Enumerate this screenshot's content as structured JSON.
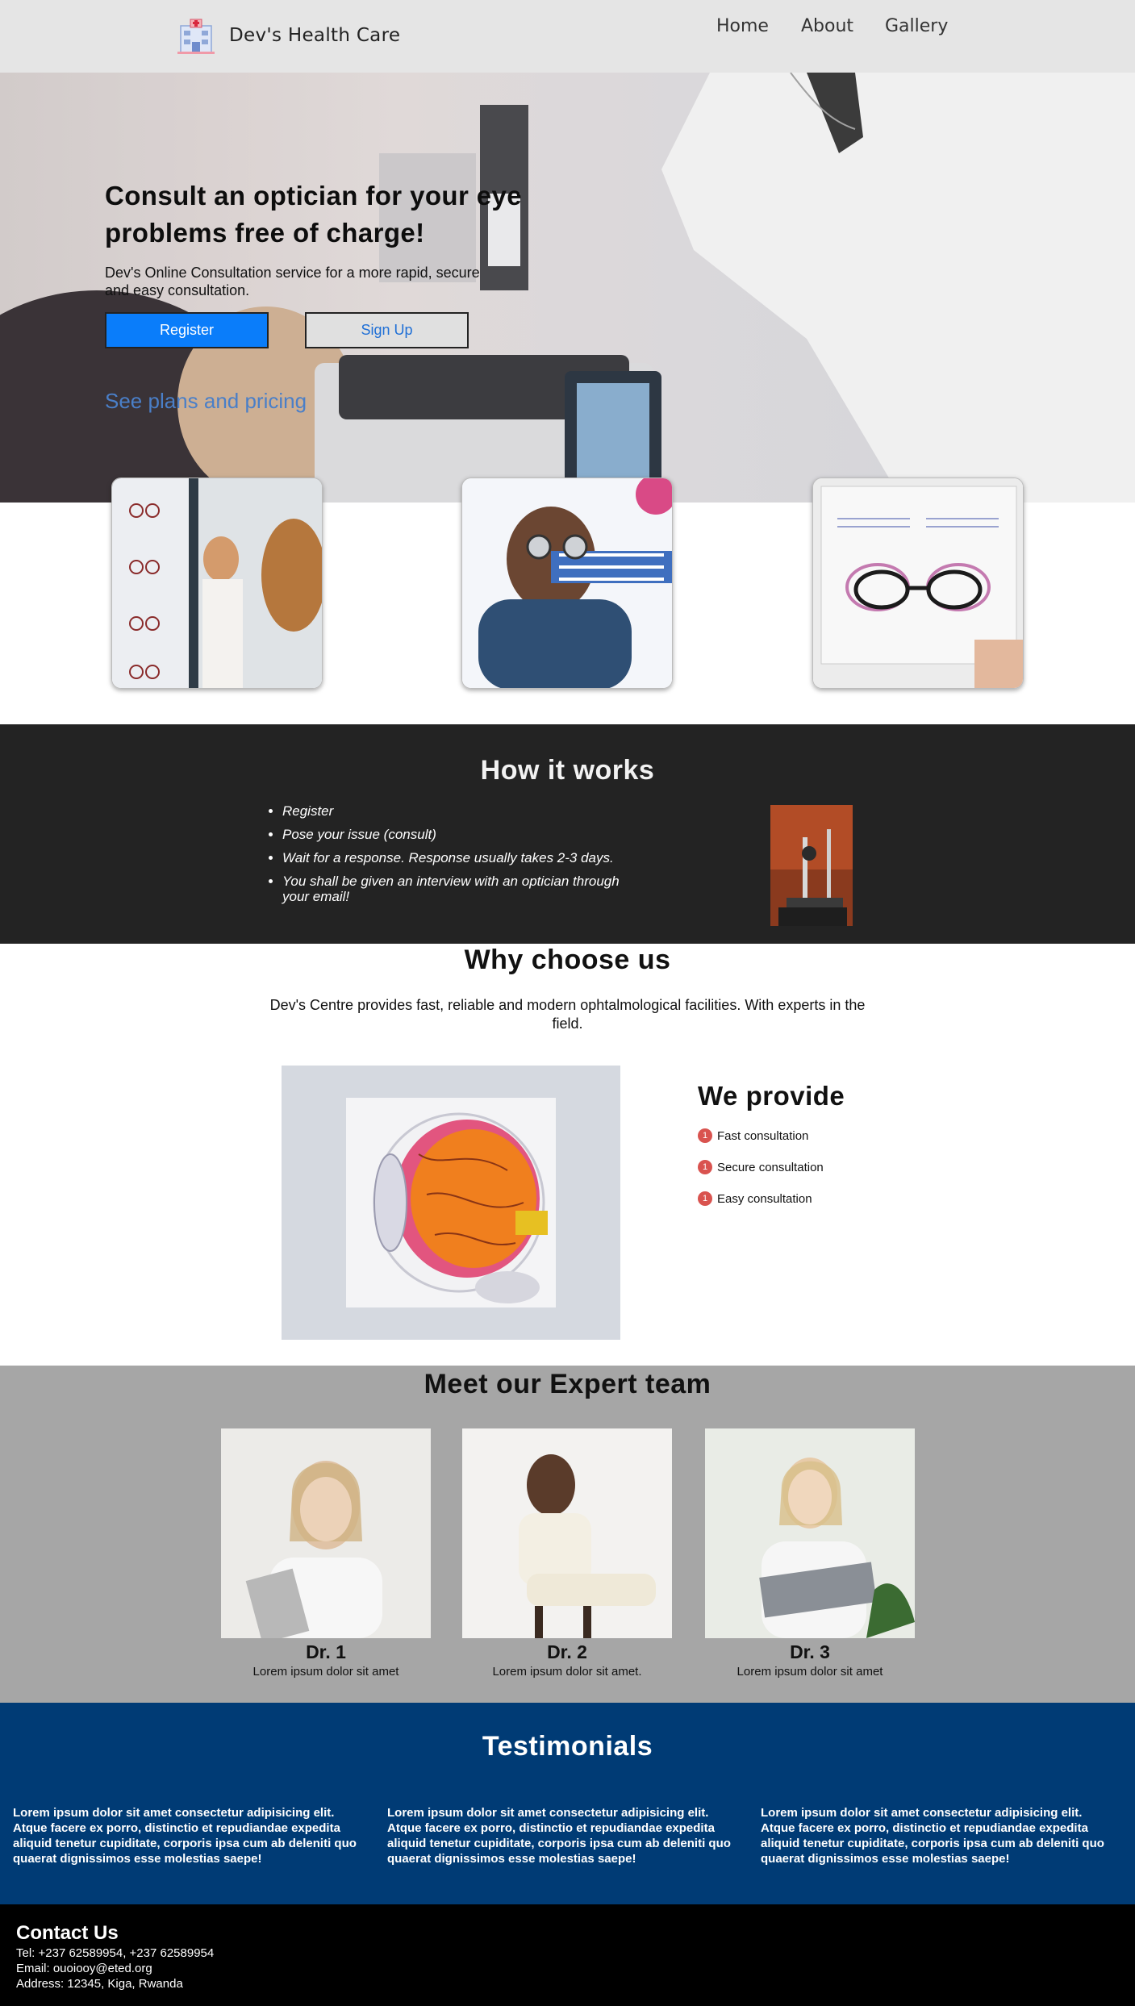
{
  "nav": {
    "brand": "Dev's Health Care",
    "links": [
      "Home",
      "About",
      "Gallery"
    ]
  },
  "hero": {
    "title": "Consult an optician for your eye problems free of charge!",
    "subtitle": "Dev's Online Consultation service for a more rapid, secure and easy consultation.",
    "register_label": "Register",
    "signup_label": "Sign Up",
    "plans_link": "See plans and pricing"
  },
  "how": {
    "title": "How it works",
    "steps": [
      "Register",
      "Pose your issue (consult)",
      "Wait for a response. Response usually takes 2-3 days.",
      "You shall be given an interview with an optician through your email!"
    ]
  },
  "why": {
    "title": "Why choose us",
    "subtitle": "Dev's Centre provides fast, reliable and modern ophtalmological facilities. With experts in the field.",
    "provide_title": "We provide",
    "provide_badge": "1",
    "provide_items": [
      "Fast consultation",
      "Secure consultation",
      "Easy consultation"
    ]
  },
  "team": {
    "title": "Meet our Expert team",
    "members": [
      {
        "name": "Dr. 1",
        "desc": "Lorem ipsum dolor sit amet"
      },
      {
        "name": "Dr. 2",
        "desc": "Lorem ipsum dolor sit amet."
      },
      {
        "name": "Dr. 3",
        "desc": "Lorem ipsum dolor sit amet"
      }
    ]
  },
  "testimonials": {
    "title": "Testimonials",
    "items": [
      "Lorem ipsum dolor sit amet consectetur adipisicing elit. Atque facere ex porro, distinctio et repudiandae expedita aliquid tenetur cupiditate, corporis ipsa cum ab deleniti quo quaerat dignissimos esse molestias saepe!",
      "Lorem ipsum dolor sit amet consectetur adipisicing elit. Atque facere ex porro, distinctio et repudiandae expedita aliquid tenetur cupiditate, corporis ipsa cum ab deleniti quo quaerat dignissimos esse molestias saepe!",
      "Lorem ipsum dolor sit amet consectetur adipisicing elit. Atque facere ex porro, distinctio et repudiandae expedita aliquid tenetur cupiditate, corporis ipsa cum ab deleniti quo quaerat dignissimos esse molestias saepe!"
    ]
  },
  "contact": {
    "title": "Contact Us",
    "tel": "Tel: +237 62589954, +237 62589954",
    "email": "Email: ouoiooy@eted.org",
    "address": "Address: 12345, Kiga, Rwanda"
  },
  "colors": {
    "nav_bg": "#e5e5e5",
    "register_blue": "#0a7dfa",
    "how_bg": "#232323",
    "team_bg": "#a6a6a6",
    "testimonials_bg": "#003b75",
    "contact_bg": "#000000",
    "badge_red": "#d9534f"
  }
}
